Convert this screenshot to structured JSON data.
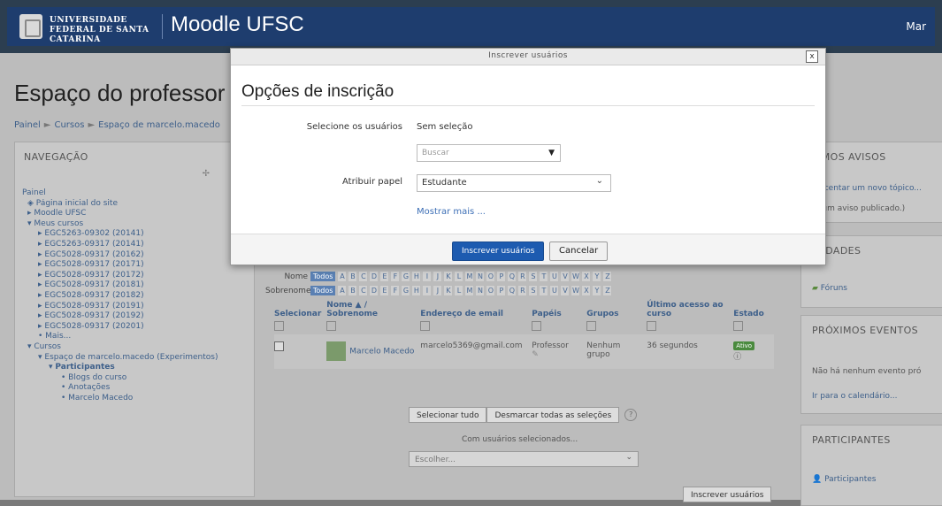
{
  "header": {
    "university": "UNIVERSIDADE FEDERAL DE SANTA CATARINA",
    "brand": "Moodle UFSC",
    "user": "Mar"
  },
  "page": {
    "title": "Espaço do professor M",
    "breadcrumb": [
      "Painel",
      "Cursos",
      "Espaço de marcelo.macedo"
    ]
  },
  "navigation": {
    "title": "NAVEGAÇÃO",
    "items": [
      {
        "label": "Painel",
        "level": 0
      },
      {
        "label": "Página inicial do site",
        "level": 1
      },
      {
        "label": "Moodle UFSC",
        "level": 1
      },
      {
        "label": "Meus cursos",
        "level": 1
      },
      {
        "label": "EGC5263-09302 (20141)",
        "level": 2
      },
      {
        "label": "EGC5263-09317 (20141)",
        "level": 2
      },
      {
        "label": "EGC5028-09317 (20162)",
        "level": 2
      },
      {
        "label": "EGC5028-09317 (20171)",
        "level": 2
      },
      {
        "label": "EGC5028-09317 (20172)",
        "level": 2
      },
      {
        "label": "EGC5028-09317 (20181)",
        "level": 2
      },
      {
        "label": "EGC5028-09317 (20182)",
        "level": 2
      },
      {
        "label": "EGC5028-09317 (20191)",
        "level": 2
      },
      {
        "label": "EGC5028-09317 (20192)",
        "level": 2
      },
      {
        "label": "EGC5028-09317 (20201)",
        "level": 2
      },
      {
        "label": "Mais...",
        "level": 2
      },
      {
        "label": "Cursos",
        "level": 1
      },
      {
        "label": "Espaço de marcelo.macedo (Experimentos)",
        "level": 2
      },
      {
        "label": "Participantes",
        "level": 3
      },
      {
        "label": "Blogs do curso",
        "level": 4
      },
      {
        "label": "Anotações",
        "level": 4
      },
      {
        "label": "Marcelo Macedo",
        "level": 4
      }
    ]
  },
  "right": {
    "news_title": "TIMOS AVISOS",
    "news_link": "rescentar um novo tópico...",
    "news_empty": "nhum aviso publicado.)",
    "activities_title": "IVIDADES",
    "forums": "Fóruns",
    "events_title": "PRÓXIMOS EVENTOS",
    "events_empty": "Não há nenhum evento pró",
    "calendar_link": "Ir para o calendário...",
    "participants_title": "PARTICIPANTES",
    "participants_link": "Participantes"
  },
  "filters": {
    "first_name_label": "Nome",
    "last_name_label": "Sobrenome",
    "all": "Todos",
    "letters": [
      "A",
      "B",
      "C",
      "D",
      "E",
      "F",
      "G",
      "H",
      "I",
      "J",
      "K",
      "L",
      "M",
      "N",
      "O",
      "P",
      "Q",
      "R",
      "S",
      "T",
      "U",
      "V",
      "W",
      "X",
      "Y",
      "Z"
    ]
  },
  "table": {
    "headers": {
      "select": "Selecionar",
      "name": "Nome",
      "sort": "/",
      "surname": "Sobrenome",
      "email": "Endereço de email",
      "roles": "Papéis",
      "groups": "Grupos",
      "last_access": "Último acesso ao curso",
      "status": "Estado"
    },
    "rows": [
      {
        "name": "Marcelo Macedo",
        "email": "marcelo5369@gmail.com",
        "role": "Professor",
        "groups": "Nenhum grupo",
        "last_access": "36 segundos",
        "status": "Ativo"
      }
    ]
  },
  "bulk": {
    "select_all": "Selecionar tudo",
    "deselect_all": "Desmarcar todas as seleções",
    "with_selected": "Com usuários selecionados...",
    "choose": "Escolher...",
    "enrol_users": "Inscrever usuários"
  },
  "modal": {
    "window_title": "Inscrever usuários",
    "close": "x",
    "heading": "Opções de inscrição",
    "select_users_label": "Selecione os usuários",
    "no_selection": "Sem seleção",
    "search_placeholder": "Buscar",
    "assign_role_label": "Atribuir papel",
    "role_value": "Estudante",
    "show_more": "Mostrar mais ...",
    "submit": "Inscrever usuários",
    "cancel": "Cancelar"
  }
}
